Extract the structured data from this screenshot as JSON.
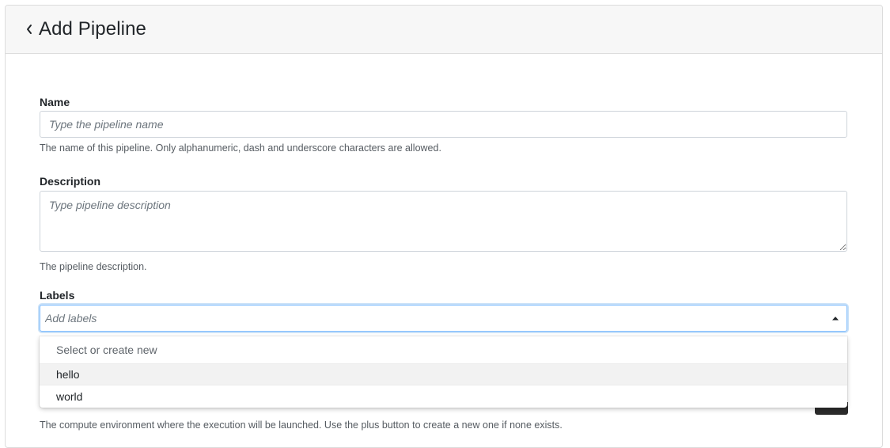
{
  "header": {
    "title": "Add Pipeline",
    "back_icon": "chevron-left-icon"
  },
  "form": {
    "name": {
      "label": "Name",
      "placeholder": "Type the pipeline name",
      "value": "",
      "help": "The name of this pipeline. Only alphanumeric, dash and underscore characters are allowed."
    },
    "description": {
      "label": "Description",
      "placeholder": "Type pipeline description",
      "value": "",
      "help": "The pipeline description."
    },
    "labels": {
      "label": "Labels",
      "placeholder": "Add labels",
      "value": "",
      "dropdown": {
        "header": "Select or create new",
        "options": [
          {
            "label": "hello",
            "highlighted": true
          },
          {
            "label": "world",
            "highlighted": false
          }
        ]
      },
      "caret_icon": "caret-up-icon"
    },
    "compute_env": {
      "help": "The compute environment where the execution will be launched. Use the plus button to create a new one if none exists."
    }
  },
  "colors": {
    "header_bg": "#f7f7f7",
    "focus_border": "#80bdff",
    "border": "#ced4da",
    "help_text": "#555b61"
  }
}
